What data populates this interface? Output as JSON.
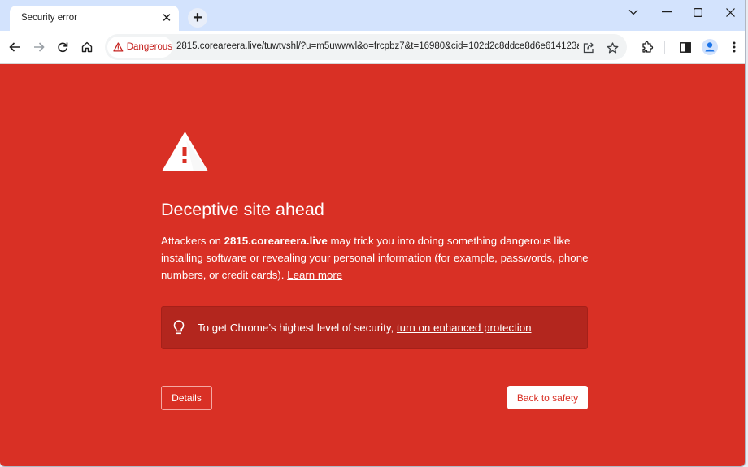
{
  "browser": {
    "tab": {
      "title": "Security error",
      "close_icon": "close-icon"
    },
    "new_tab_icon": "plus-icon",
    "window_controls": {
      "tab_search": "chevron-down-icon",
      "minimize": "minimize-icon",
      "maximize": "maximize-icon",
      "close": "close-icon"
    },
    "toolbar": {
      "back": "arrow-left-icon",
      "forward": "arrow-right-icon",
      "reload": "reload-icon",
      "home": "home-icon",
      "security_chip": {
        "icon": "warning-triangle-icon",
        "label": "Dangerous"
      },
      "url": "2815.coreareera.live/tuwtvshl/?u=m5uwwwl&o=frcpbz7&t=16980&cid=102d2c8ddce8d6e614123aa97...",
      "share": "share-icon",
      "bookmark": "star-icon",
      "extensions": "puzzle-icon",
      "side_panel": "side-panel-icon",
      "profile": "profile-avatar-icon",
      "menu": "kebab-menu-icon"
    }
  },
  "interstitial": {
    "icon": "warning-triangle-icon",
    "heading": "Deceptive site ahead",
    "body": {
      "prefix": "Attackers on ",
      "domain": "2815.coreareera.live",
      "suffix": " may trick you into doing something dangerous like installing software or revealing your personal information (for example, passwords, phone numbers, or credit cards). ",
      "learn_more": "Learn more"
    },
    "promo": {
      "icon": "lightbulb-icon",
      "text": "To get Chrome’s highest level of security, ",
      "link": "turn on enhanced protection"
    },
    "buttons": {
      "details": "Details",
      "back_to_safety": "Back to safety"
    }
  },
  "colors": {
    "danger_background": "#d93025",
    "promo_background": "#b3261e",
    "tabstrip": "#d3e3fd",
    "dangerous_chip_text": "#c5221f",
    "profile_blue": "#1a73e8"
  }
}
